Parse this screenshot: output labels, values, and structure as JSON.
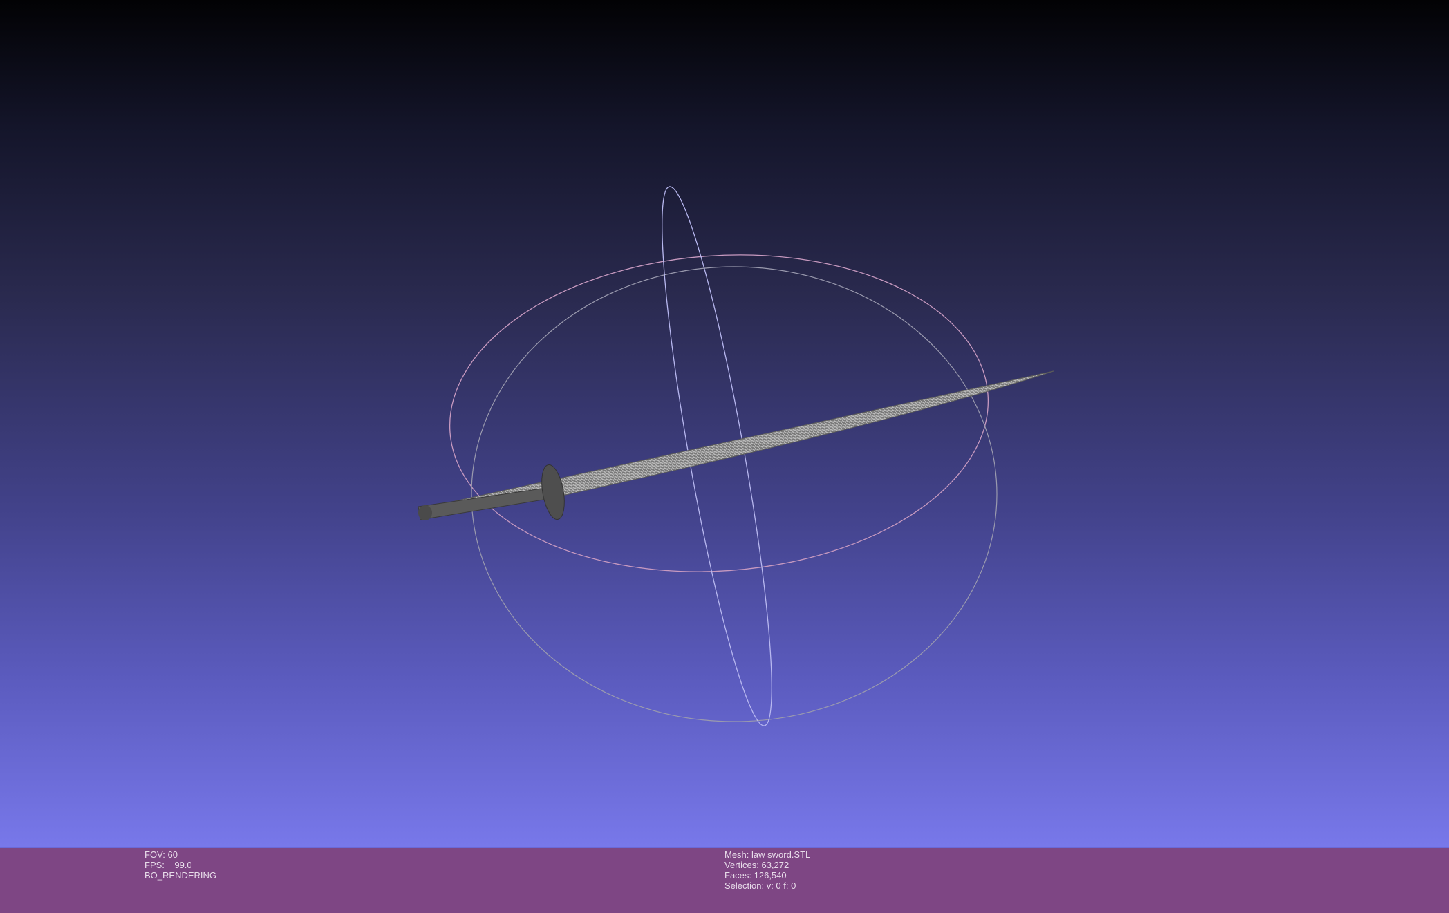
{
  "left_info": {
    "fov": "FOV: 60",
    "fps": "FPS:    99.0",
    "render_mode": "BO_RENDERING"
  },
  "mesh_info": {
    "mesh": "Mesh: law sword.STL",
    "vertices": "Vertices: 63,272",
    "faces": "Faces: 126,540",
    "selection": "Selection: v: 0 f: 0"
  },
  "colors": {
    "statusbar": "#7e4684",
    "mesh": "#8a8a8a"
  }
}
